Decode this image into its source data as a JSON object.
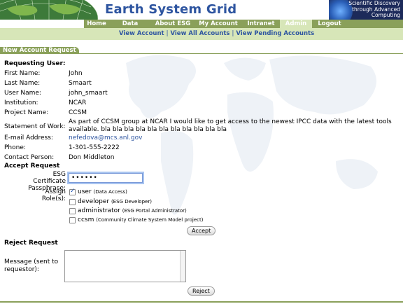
{
  "header": {
    "site_title": "Earth System Grid",
    "sd_logo_lines": [
      "Scientific Discovery",
      "through Advanced",
      "Computing"
    ]
  },
  "nav": {
    "tabs": [
      {
        "label": "Home"
      },
      {
        "label": "Data"
      },
      {
        "label": "About ESG"
      },
      {
        "label": "My Account"
      },
      {
        "label": "Intranet"
      },
      {
        "label": "Admin"
      },
      {
        "label": "Logout"
      }
    ],
    "active": "Admin"
  },
  "subnav": {
    "links": [
      "View Account",
      "View All Accounts",
      "View Pending Accounts"
    ]
  },
  "section_tab": "New Account Request",
  "requesting_user": {
    "heading": "Requesting User:",
    "fields": [
      {
        "label": "First Name:",
        "value": "John"
      },
      {
        "label": "Last Name:",
        "value": "Smaart"
      },
      {
        "label": "User Name:",
        "value": "john_smaart"
      },
      {
        "label": "Institution:",
        "value": "NCAR"
      },
      {
        "label": "Project Name:",
        "value": "CCSM"
      }
    ],
    "statement_label": "Statement of Work:",
    "statement_lines": [
      "As part of CCSM group at NCAR I would like to get access to the newest IPCC data with the latest tools",
      "available. bla bla bla bla bla bla bla bla bla bla bla"
    ],
    "email_label": "E-mail Address:",
    "email_value": "nefedova@mcs.anl.gov",
    "phone_label": "Phone:",
    "phone_value": "1-301-555-2222",
    "contact_label": "Contact Person:",
    "contact_value": "Don Middleton"
  },
  "accept": {
    "heading": "Accept Request",
    "pass_label_1": "ESG Certificate",
    "pass_label_2": "Passphrase:",
    "pass_value": "••••••",
    "roles_label": "Assign Role(s):",
    "roles": [
      {
        "name": "user",
        "desc": "(Data Access)",
        "checked": true
      },
      {
        "name": "developer",
        "desc": "(ESG Developer)",
        "checked": false
      },
      {
        "name": "administrator",
        "desc": "(ESG Portal Administrator)",
        "checked": false
      },
      {
        "name": "ccsm",
        "desc": "(Community Climate System Model project)",
        "checked": false
      }
    ],
    "button": "Accept"
  },
  "reject": {
    "heading": "Reject Request",
    "message_label_1": "Message (sent to",
    "message_label_2": "requestor):",
    "message_value": "",
    "button": "Reject"
  },
  "colors": {
    "brand_blue": "#2e55a0",
    "nav_green": "#8aa05a",
    "subnav_green": "#d7e6b8"
  }
}
